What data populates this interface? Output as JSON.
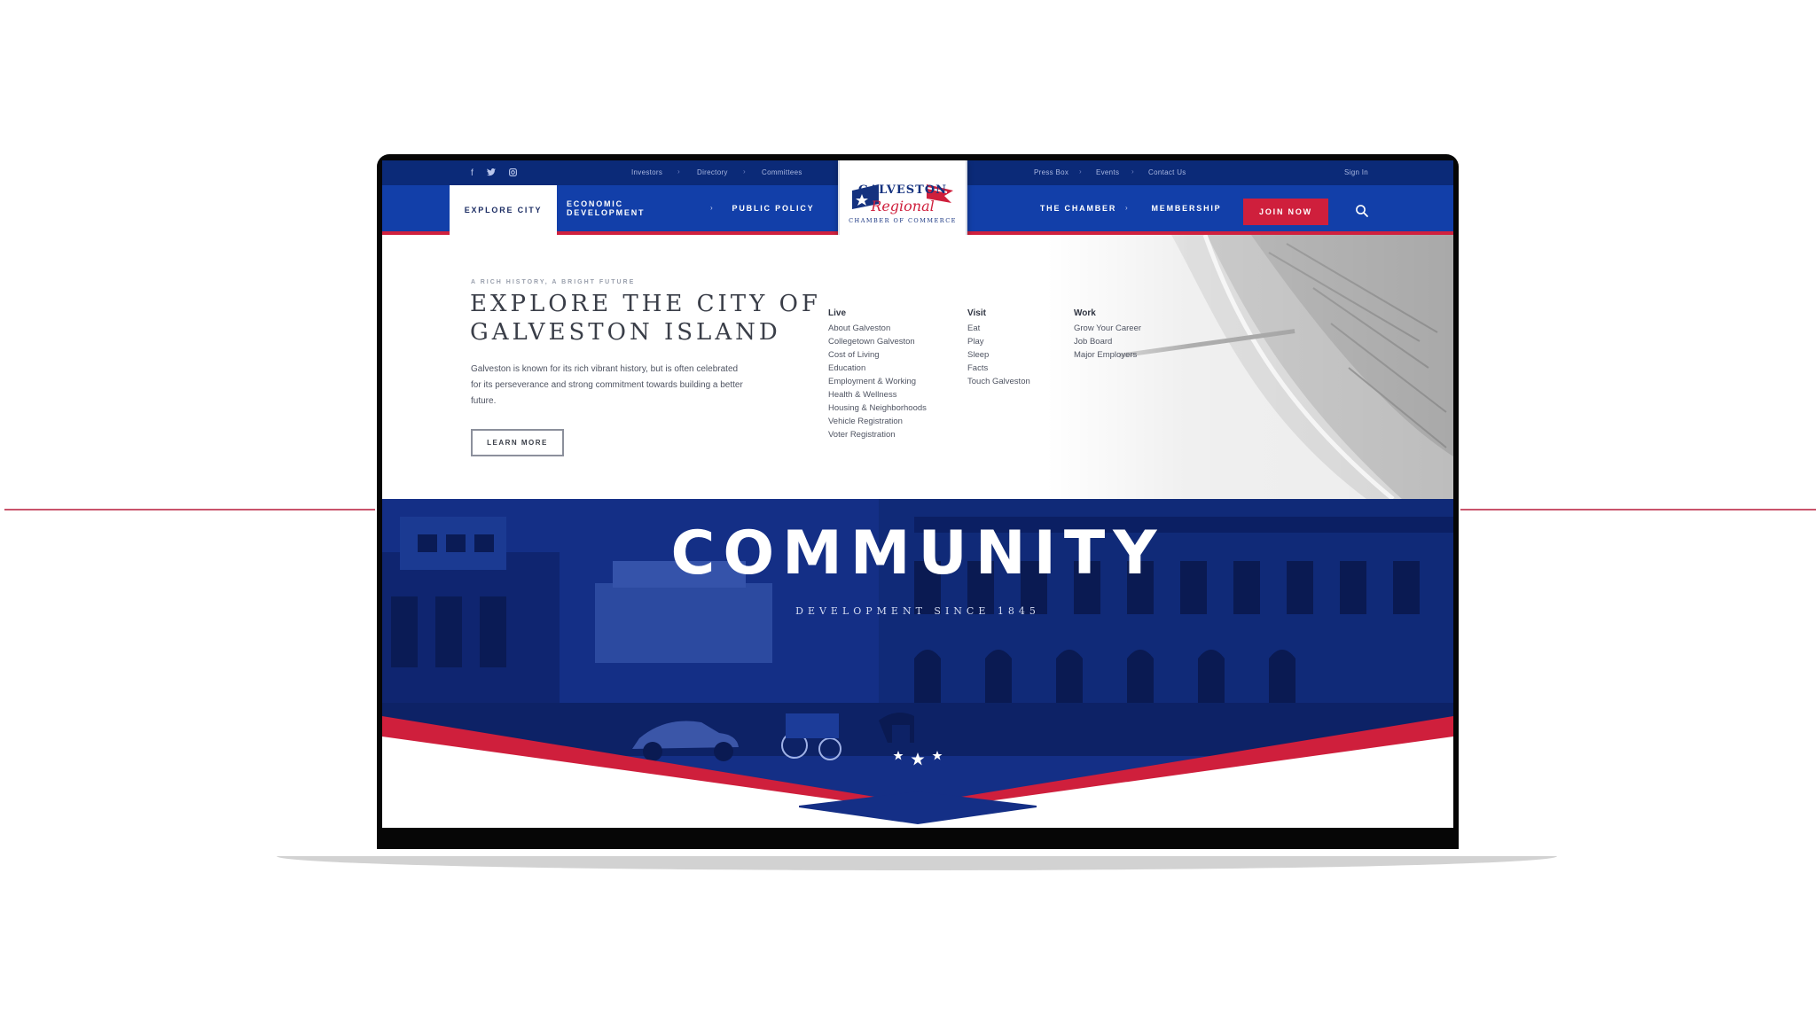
{
  "top_bar": {
    "social_icons": [
      "facebook-icon",
      "twitter-icon",
      "instagram-icon"
    ],
    "left_links": [
      "Investors",
      "Directory",
      "Committees"
    ],
    "right_links": [
      "Press Box",
      "Events",
      "Contact Us"
    ],
    "sign_in": "Sign In"
  },
  "nav": {
    "left_items": [
      "EXPLORE CITY",
      "ECONOMIC DEVELOPMENT",
      "PUBLIC POLICY"
    ],
    "right_items": [
      "THE CHAMBER",
      "MEMBERSHIP"
    ],
    "join_label": "JOIN NOW",
    "search_icon": "search-icon"
  },
  "logo": {
    "line1": "GALVESTON",
    "line2": "Regional",
    "line3": "CHAMBER OF COMMERCE"
  },
  "dropdown": {
    "kicker": "A RICH HISTORY, A BRIGHT FUTURE",
    "headline_line1": "EXPLORE THE CITY OF",
    "headline_line2": "GALVESTON ISLAND",
    "desc_line1": "Galveston is known for its rich vibrant history, but is often celebrated",
    "desc_line2": "for its perseverance and strong commitment towards building a better",
    "desc_line3": "future.",
    "learn_more": "LEARN MORE",
    "columns": [
      {
        "heading": "Live",
        "links": [
          "About Galveston",
          "Collegetown Galveston",
          "Cost of Living",
          "Education",
          "Employment & Working",
          "Health & Wellness",
          "Housing & Neighborhoods",
          "Vehicle Registration",
          "Voter Registration"
        ]
      },
      {
        "heading": "Visit",
        "links": [
          "Eat",
          "Play",
          "Sleep",
          "Facts",
          "Touch Galveston"
        ]
      },
      {
        "heading": "Work",
        "links": [
          "Grow Your Career",
          "Job Board",
          "Major Employers"
        ]
      }
    ]
  },
  "hero": {
    "title": "COMMUNITY",
    "subtitle": "DEVELOPMENT SINCE 1845"
  },
  "colors": {
    "navy": "#0b2a78",
    "blue": "#123fa9",
    "red": "#cf1f3c",
    "white": "#ffffff"
  }
}
